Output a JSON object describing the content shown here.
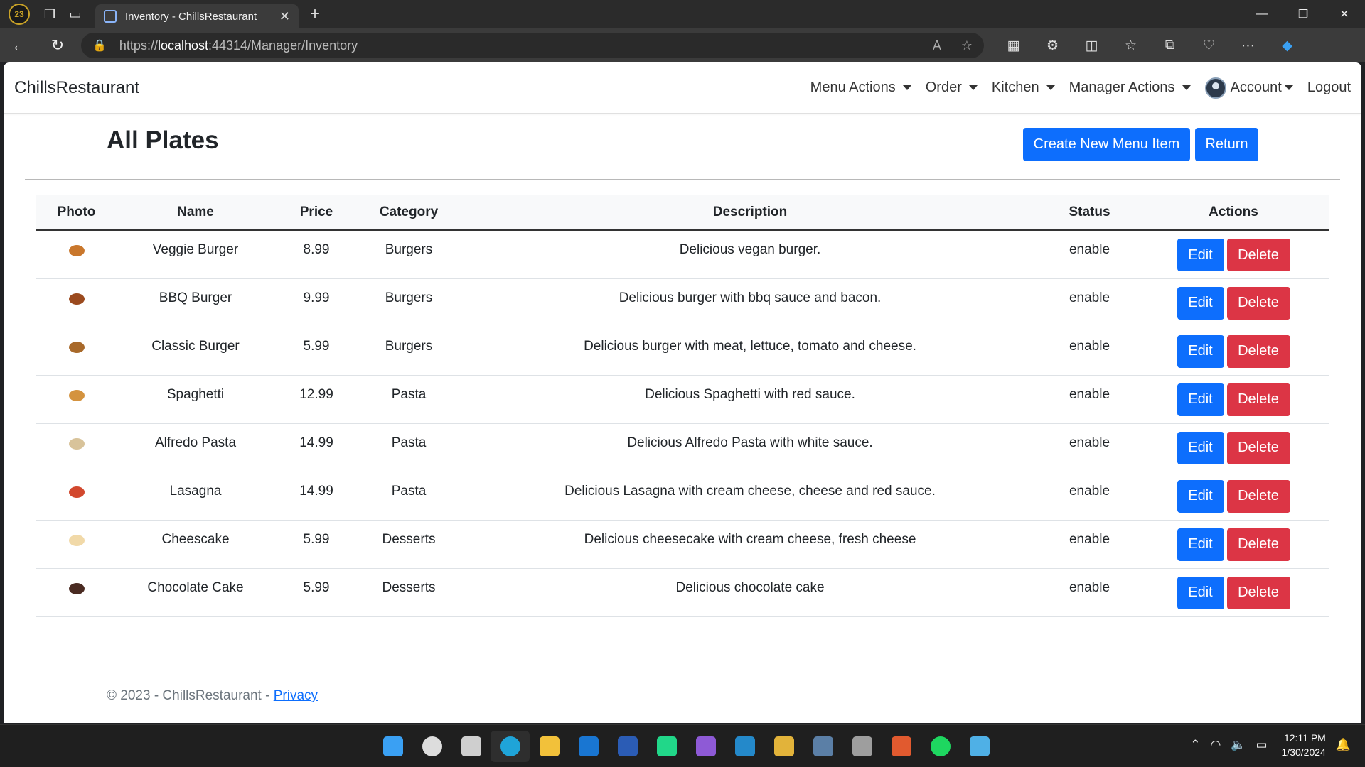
{
  "browser": {
    "tab_title": "Inventory - ChillsRestaurant",
    "url_scheme": "https://",
    "url_host": "localhost",
    "url_rest": ":44314/Manager/Inventory"
  },
  "navbar": {
    "brand": "ChillsRestaurant",
    "items": [
      {
        "label": "Menu Actions"
      },
      {
        "label": "Order"
      },
      {
        "label": "Kitchen"
      },
      {
        "label": "Manager Actions"
      }
    ],
    "account_label": "Account",
    "logout_label": "Logout"
  },
  "page": {
    "title": "All Plates",
    "create_label": "Create New Menu Item",
    "return_label": "Return"
  },
  "table": {
    "headers": [
      "Photo",
      "Name",
      "Price",
      "Category",
      "Description",
      "Status",
      "Actions"
    ],
    "edit_label": "Edit",
    "delete_label": "Delete",
    "rows": [
      {
        "name": "Veggie Burger",
        "price": "8.99",
        "category": "Burgers",
        "description": "Delicious vegan burger.",
        "status": "enable",
        "photo_color": "#c9772c"
      },
      {
        "name": "BBQ Burger",
        "price": "9.99",
        "category": "Burgers",
        "description": "Delicious burger with bbq sauce and bacon.",
        "status": "enable",
        "photo_color": "#9b4a1e"
      },
      {
        "name": "Classic Burger",
        "price": "5.99",
        "category": "Burgers",
        "description": "Delicious burger with meat, lettuce, tomato and cheese.",
        "status": "enable",
        "photo_color": "#a8692a"
      },
      {
        "name": "Spaghetti",
        "price": "12.99",
        "category": "Pasta",
        "description": "Delicious Spaghetti with red sauce.",
        "status": "enable",
        "photo_color": "#d4933f"
      },
      {
        "name": "Alfredo Pasta",
        "price": "14.99",
        "category": "Pasta",
        "description": "Delicious Alfredo Pasta with white sauce.",
        "status": "enable",
        "photo_color": "#d8c39a"
      },
      {
        "name": "Lasagna",
        "price": "14.99",
        "category": "Pasta",
        "description": "Delicious Lasagna with cream cheese, cheese and red sauce.",
        "status": "enable",
        "photo_color": "#d2482e"
      },
      {
        "name": "Cheescake",
        "price": "5.99",
        "category": "Desserts",
        "description": "Delicious cheesecake with cream cheese, fresh cheese",
        "status": "enable",
        "photo_color": "#f1d9a8"
      },
      {
        "name": "Chocolate Cake",
        "price": "5.99",
        "category": "Desserts",
        "description": "Delicious chocolate cake",
        "status": "enable",
        "photo_color": "#4a2b22"
      }
    ]
  },
  "footer": {
    "text": "© 2023 - ChillsRestaurant - ",
    "privacy_label": "Privacy"
  },
  "taskbar": {
    "apps": [
      {
        "name": "start-icon",
        "color": "#3aa0f3"
      },
      {
        "name": "search-icon",
        "color": "#dddddd"
      },
      {
        "name": "task-view-icon",
        "color": "#cfcfcf"
      },
      {
        "name": "edge-icon",
        "color": "#1fa4d8"
      },
      {
        "name": "file-explorer-icon",
        "color": "#f2c13a"
      },
      {
        "name": "outlook-icon",
        "color": "#1976d2"
      },
      {
        "name": "word-icon",
        "color": "#2b5cb5"
      },
      {
        "name": "pycharm-icon",
        "color": "#21d789"
      },
      {
        "name": "visual-studio-icon",
        "color": "#8e5ad6"
      },
      {
        "name": "vscode-icon",
        "color": "#2489ca"
      },
      {
        "name": "tools-icon",
        "color": "#e2b33a"
      },
      {
        "name": "sql-icon",
        "color": "#5b7fa6"
      },
      {
        "name": "database-icon",
        "color": "#9e9e9e"
      },
      {
        "name": "git-icon",
        "color": "#e15a2f"
      },
      {
        "name": "spotify-icon",
        "color": "#1ed760"
      },
      {
        "name": "notepad-icon",
        "color": "#4fb0e6"
      }
    ],
    "time": "12:11 PM",
    "date": "1/30/2024"
  }
}
